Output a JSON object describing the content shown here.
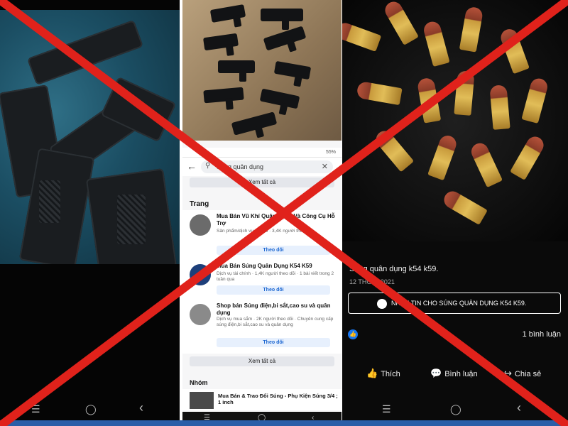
{
  "facebook_screen": {
    "search_query": "Súng quân dụng",
    "see_all_top": "Xem tất cả",
    "section_pages": "Trang",
    "pages": [
      {
        "title": "Mua Bán Vũ Khí Quân Dụng Và Công Cụ Hỗ Trợ",
        "meta": "Sản phẩm/dịch vụ · 1,0/5 · 3,4K người theo dõi",
        "follow": "Theo dõi"
      },
      {
        "title": "Mua Bán Súng Quân Dụng K54 K59",
        "meta": "Dịch vụ tài chính · 1,4K người theo dõi · 1 bài viết trong 2 tuần qua",
        "follow": "Theo dõi"
      },
      {
        "title": "Shop bán Súng điện,bi sắt,cao su và quân dụng",
        "meta": "Dịch vụ mua sắm · 2K người theo dõi · Chuyên cung cấp súng điện,bi sắt,cao su và quân dụng",
        "follow": "Theo dõi"
      }
    ],
    "see_all_bottom": "Xem tất cả",
    "section_groups": "Nhóm",
    "group_title": "Mua Bán & Trao Đổi Súng - Phụ Kiện Súng 3/4 ; 1 inch",
    "status": "55%"
  },
  "post_screen": {
    "title": "Súng quân dụng k54 k59.",
    "date": "12 THG 6, 2021",
    "message_button": "NHẮN TIN CHO SÚNG QUÂN DỤNG K54 K59.",
    "comment_count": "1 bình luận",
    "actions": {
      "like": "Thích",
      "comment": "Bình luận",
      "share": "Chia sẻ"
    }
  },
  "nav_glyphs": {
    "menu": "☰",
    "home": "◯",
    "back": "‹"
  },
  "colors": {
    "cross": "#e0221b",
    "facebook_blue": "#1877f2",
    "brass": "#d4a843",
    "copper": "#a9472f"
  }
}
